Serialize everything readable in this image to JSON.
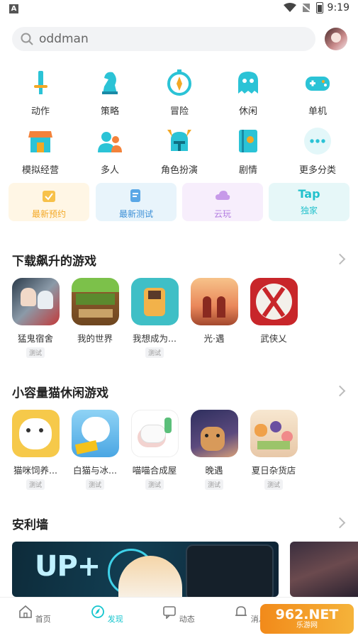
{
  "status": {
    "time": "9:19"
  },
  "search": {
    "query": "oddman"
  },
  "categories": [
    {
      "label": "动作",
      "icon": "sword-icon"
    },
    {
      "label": "策略",
      "icon": "chess-knight-icon"
    },
    {
      "label": "冒险",
      "icon": "compass-icon"
    },
    {
      "label": "休闲",
      "icon": "ghost-icon"
    },
    {
      "label": "单机",
      "icon": "gamepad-icon"
    },
    {
      "label": "模拟经营",
      "icon": "shop-icon"
    },
    {
      "label": "多人",
      "icon": "people-icon"
    },
    {
      "label": "角色扮演",
      "icon": "helmet-icon"
    },
    {
      "label": "剧情",
      "icon": "book-icon"
    },
    {
      "label": "更多分类",
      "icon": "more-icon"
    }
  ],
  "tiles": [
    {
      "label": "最新预约",
      "bg": "#fff6e5",
      "fg": "#f3a825"
    },
    {
      "label": "最新测试",
      "bg": "#e8f4fb",
      "fg": "#3a8ed6"
    },
    {
      "label": "云玩",
      "bg": "#f7eefc",
      "fg": "#b27be0"
    },
    {
      "label": "独家",
      "top": "Tap",
      "bg": "#e6f7f8",
      "fg": "#22c1cc"
    }
  ],
  "sections": [
    {
      "title": "下载飙升的游戏",
      "games": [
        {
          "name": "猛鬼宿舍",
          "badge": "测试"
        },
        {
          "name": "我的世界",
          "badge": ""
        },
        {
          "name": "我想成为...",
          "badge": "测试"
        },
        {
          "name": "光·遇",
          "badge": ""
        },
        {
          "name": "武侠乂",
          "badge": ""
        }
      ]
    },
    {
      "title": "小容量猫休闲游戏",
      "games": [
        {
          "name": "猫咪饲养...",
          "badge": "测试"
        },
        {
          "name": "白猫与冰...",
          "badge": "测试"
        },
        {
          "name": "喵喵合成屋",
          "badge": "测试"
        },
        {
          "name": "晚遇",
          "badge": "测试"
        },
        {
          "name": "夏日杂货店",
          "badge": "测试"
        }
      ]
    },
    {
      "title": "安利墙"
    }
  ],
  "banner": {
    "text": "UP+"
  },
  "nav": [
    {
      "label": "首页",
      "active": false
    },
    {
      "label": "发现",
      "active": true
    },
    {
      "label": "动态",
      "active": false
    },
    {
      "label": "消息",
      "active": false
    }
  ],
  "watermark": {
    "line1": "962.NET",
    "line2": "乐游网"
  },
  "colors": {
    "accent": "#15c5ce",
    "iconCyan": "#2bc3d6"
  }
}
